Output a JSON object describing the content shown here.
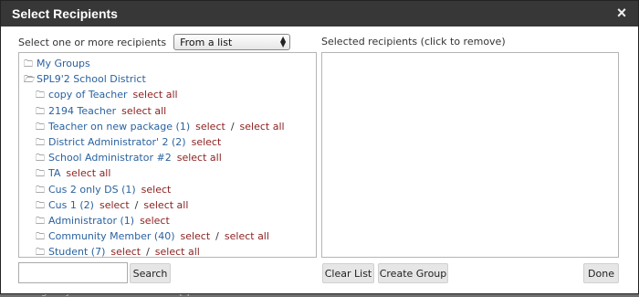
{
  "dialog": {
    "title": "Select Recipients",
    "close_glyph": "×"
  },
  "left": {
    "label": "Select one or more recipients",
    "source_select": {
      "value": "From a list"
    }
  },
  "right": {
    "label": "Selected recipients (click to remove)"
  },
  "tree": {
    "root": "My Groups",
    "district": "SPL9'2 School District",
    "items": [
      {
        "name": "copy of Teacher",
        "select": "",
        "select_all": "select all"
      },
      {
        "name": "2194 Teacher",
        "select": "",
        "select_all": "select all"
      },
      {
        "name": "Teacher on new package (1)",
        "select": "select",
        "select_all": "select all"
      },
      {
        "name": "District Administrator' 2 (2)",
        "select": "select",
        "select_all": ""
      },
      {
        "name": "School Administrator #2",
        "select": "",
        "select_all": "select all"
      },
      {
        "name": "TA",
        "select": "",
        "select_all": "select all"
      },
      {
        "name": "Cus 2 only DS (1)",
        "select": "select",
        "select_all": ""
      },
      {
        "name": "Cus 1 (2)",
        "select": "select",
        "select_all": "select all"
      },
      {
        "name": "Administrator (1)",
        "select": "select",
        "select_all": ""
      },
      {
        "name": "Community Member (40)",
        "select": "select",
        "select_all": "select all"
      },
      {
        "name": "Student (7)",
        "select": "select",
        "select_all": "select all"
      }
    ],
    "separator": "/"
  },
  "footer": {
    "search_value": "",
    "search_button": "Search",
    "clear_button": "Clear List",
    "create_button": "Create Group",
    "done_button": "Done"
  },
  "icons": {
    "folder_closed": "folder-icon",
    "folder_open": "folder-open-icon",
    "folder_glyph": "🗀"
  },
  "colors": {
    "titlebar": "#373737",
    "link": "#2a62a0",
    "select_link": "#8b1f1f"
  },
  "background": {
    "partial_text_left": "Emergency",
    "partial_text_right": "[ ]"
  }
}
